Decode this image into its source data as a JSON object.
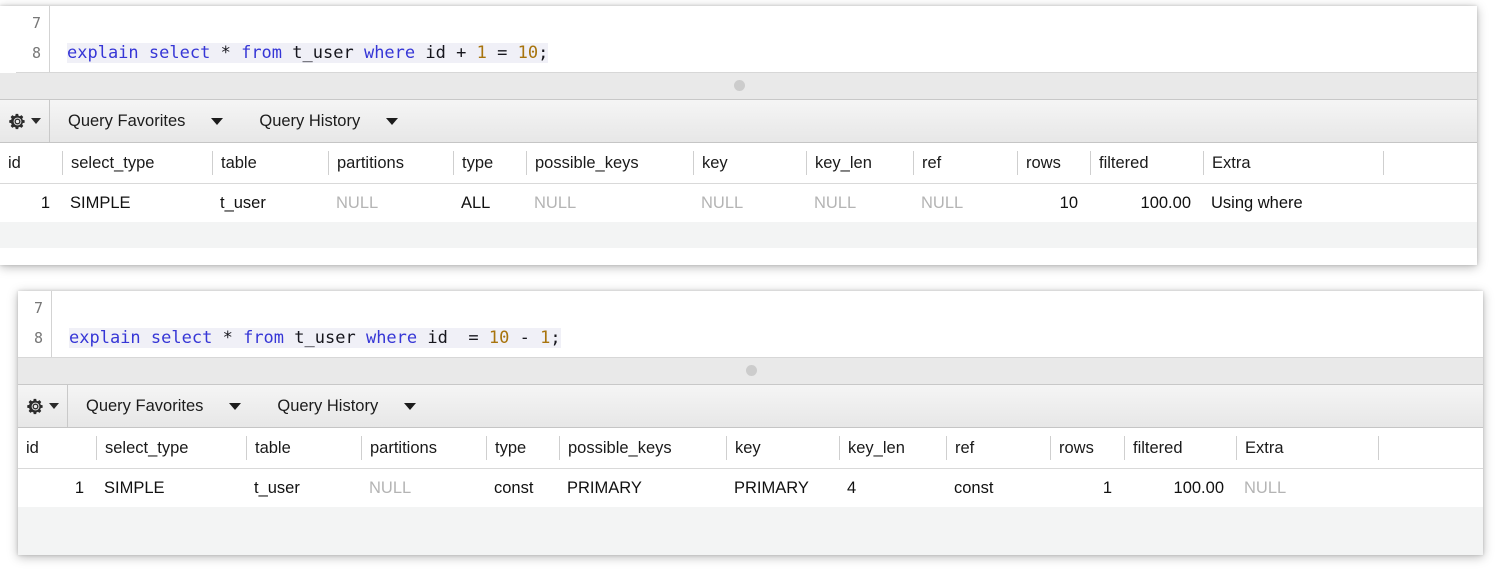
{
  "panels": [
    {
      "editor": {
        "line_numbers": [
          "7",
          "8"
        ],
        "sql_tokens": [
          {
            "t": "explain",
            "c": "kw"
          },
          {
            "t": " ",
            "c": "pln"
          },
          {
            "t": "select",
            "c": "kw"
          },
          {
            "t": " ",
            "c": "pln"
          },
          {
            "t": "*",
            "c": "op"
          },
          {
            "t": " ",
            "c": "pln"
          },
          {
            "t": "from",
            "c": "kw"
          },
          {
            "t": " ",
            "c": "pln"
          },
          {
            "t": "t_user",
            "c": "pln"
          },
          {
            "t": " ",
            "c": "pln"
          },
          {
            "t": "where",
            "c": "kw"
          },
          {
            "t": " ",
            "c": "pln"
          },
          {
            "t": "id",
            "c": "pln"
          },
          {
            "t": " ",
            "c": "pln"
          },
          {
            "t": "+",
            "c": "op"
          },
          {
            "t": " ",
            "c": "pln"
          },
          {
            "t": "1",
            "c": "num"
          },
          {
            "t": " ",
            "c": "pln"
          },
          {
            "t": "=",
            "c": "op"
          },
          {
            "t": " ",
            "c": "pln"
          },
          {
            "t": "10",
            "c": "num"
          },
          {
            "t": ";",
            "c": "op"
          }
        ],
        "sql_text": "explain select * from t_user where id + 1 = 10;"
      },
      "toolbar": {
        "gear_icon": "gear-icon",
        "gear_caret_icon": "caret-down-icon",
        "items": [
          {
            "label": "Query Favorites",
            "caret_icon": "chevron-down-icon"
          },
          {
            "label": "Query History",
            "caret_icon": "chevron-down-icon"
          }
        ]
      },
      "grid": {
        "columns": [
          "id",
          "select_type",
          "table",
          "partitions",
          "type",
          "possible_keys",
          "key",
          "key_len",
          "ref",
          "rows",
          "filtered",
          "Extra",
          ""
        ],
        "rows": [
          {
            "id": "1",
            "select_type": "SIMPLE",
            "table": "t_user",
            "partitions": "NULL",
            "type": "ALL",
            "possible_keys": "NULL",
            "key": "NULL",
            "key_len": "NULL",
            "ref": "NULL",
            "rows": "10",
            "filtered": "100.00",
            "Extra": "Using where"
          }
        ]
      }
    },
    {
      "editor": {
        "line_numbers": [
          "7",
          "8"
        ],
        "sql_tokens": [
          {
            "t": "explain",
            "c": "kw"
          },
          {
            "t": " ",
            "c": "pln"
          },
          {
            "t": "select",
            "c": "kw"
          },
          {
            "t": " ",
            "c": "pln"
          },
          {
            "t": "*",
            "c": "op"
          },
          {
            "t": " ",
            "c": "pln"
          },
          {
            "t": "from",
            "c": "kw"
          },
          {
            "t": " ",
            "c": "pln"
          },
          {
            "t": "t_user",
            "c": "pln"
          },
          {
            "t": " ",
            "c": "pln"
          },
          {
            "t": "where",
            "c": "kw"
          },
          {
            "t": " ",
            "c": "pln"
          },
          {
            "t": "id",
            "c": "pln"
          },
          {
            "t": "  ",
            "c": "pln"
          },
          {
            "t": "=",
            "c": "op"
          },
          {
            "t": " ",
            "c": "pln"
          },
          {
            "t": "10",
            "c": "num"
          },
          {
            "t": " ",
            "c": "pln"
          },
          {
            "t": "-",
            "c": "op"
          },
          {
            "t": " ",
            "c": "pln"
          },
          {
            "t": "1",
            "c": "num"
          },
          {
            "t": ";",
            "c": "op"
          }
        ],
        "sql_text": "explain select * from t_user where id  = 10 - 1;"
      },
      "toolbar": {
        "gear_icon": "gear-icon",
        "gear_caret_icon": "caret-down-icon",
        "items": [
          {
            "label": "Query Favorites",
            "caret_icon": "chevron-down-icon"
          },
          {
            "label": "Query History",
            "caret_icon": "chevron-down-icon"
          }
        ]
      },
      "grid": {
        "columns": [
          "id",
          "select_type",
          "table",
          "partitions",
          "type",
          "possible_keys",
          "key",
          "key_len",
          "ref",
          "rows",
          "filtered",
          "Extra",
          ""
        ],
        "rows": [
          {
            "id": "1",
            "select_type": "SIMPLE",
            "table": "t_user",
            "partitions": "NULL",
            "type": "const",
            "possible_keys": "PRIMARY",
            "key": "PRIMARY",
            "key_len": "4",
            "ref": "const",
            "rows": "1",
            "filtered": "100.00",
            "Extra": "NULL"
          }
        ]
      }
    }
  ],
  "colors": {
    "keyword": "#3636d6",
    "number": "#a8740d",
    "null_text": "#b4b4b4",
    "toolbar_bg": "#e9e9e9",
    "panel_bg": "#ffffff"
  }
}
